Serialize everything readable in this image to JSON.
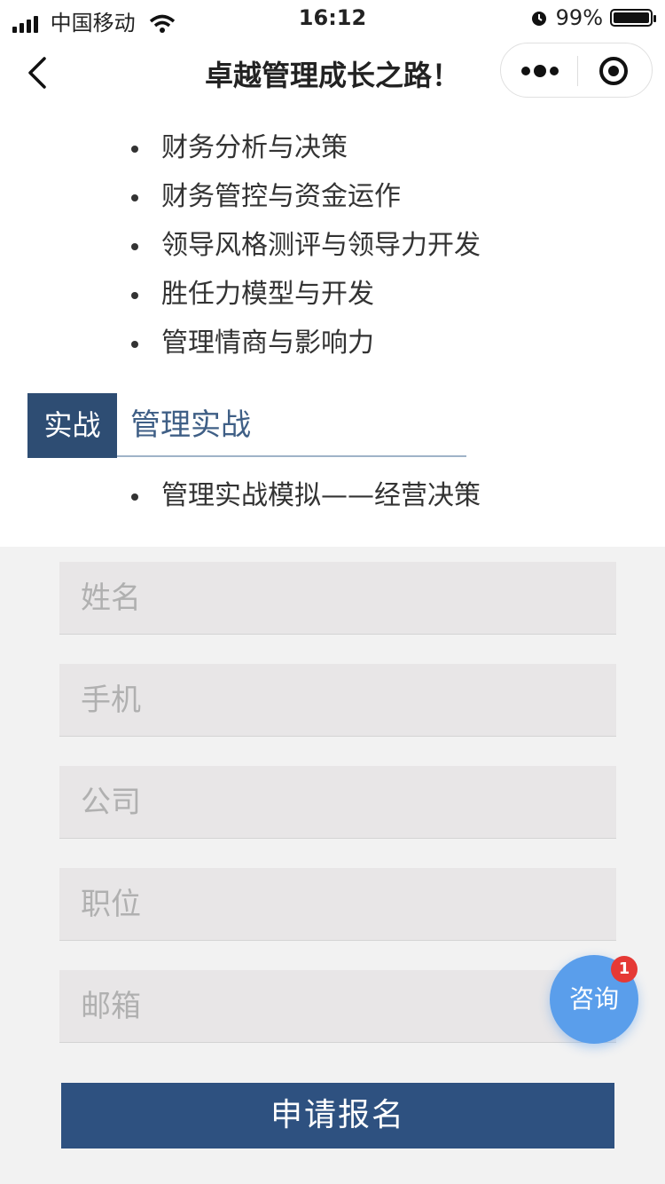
{
  "status_bar": {
    "carrier": "中国移动",
    "time": "16:12",
    "battery": "99%",
    "battery_level": 0.99
  },
  "nav": {
    "title": "卓越管理成长之路！",
    "icons": [
      "back-icon",
      "more-icon",
      "target-icon"
    ]
  },
  "course_list": [
    "财务分析与决策",
    "财务管控与资金运作",
    "领导风格测评与领导力开发",
    "胜任力模型与开发",
    "管理情商与影响力"
  ],
  "section": {
    "badge": "实战",
    "title": "管理实战",
    "items": [
      "管理实战模拟——经营决策"
    ]
  },
  "form": {
    "name_placeholder": "姓名",
    "phone_placeholder": "手机",
    "company_placeholder": "公司",
    "position_placeholder": "职位",
    "email_placeholder": "邮箱",
    "submit_label": "申请报名"
  },
  "consult": {
    "label": "咨询",
    "badge_count": "1"
  },
  "colors": {
    "accent": "#2e4d73",
    "button": "#2e5180",
    "consult": "#5a9eeb",
    "badge": "#e53935"
  }
}
